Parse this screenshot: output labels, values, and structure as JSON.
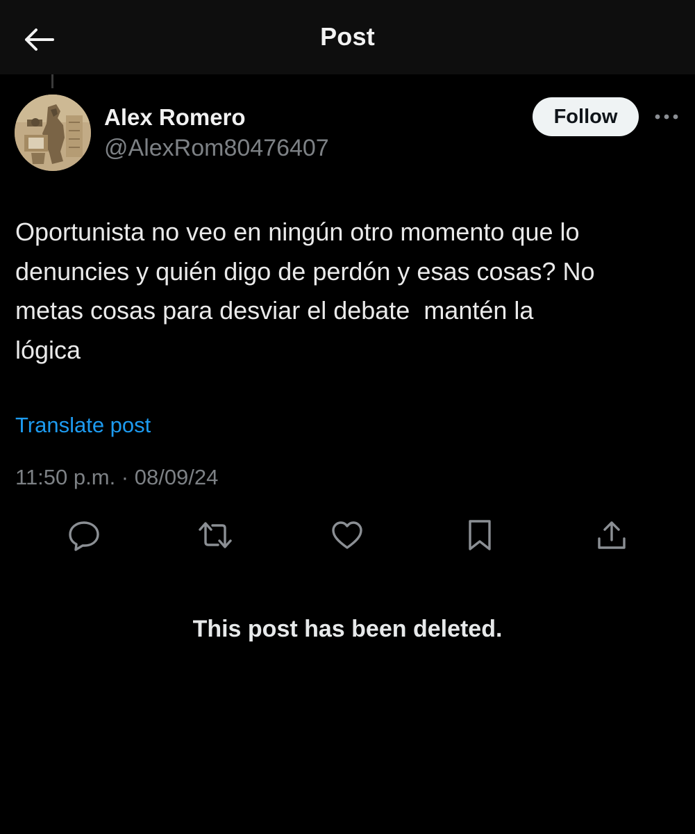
{
  "header": {
    "title": "Post",
    "back_icon": "arrow-left-icon"
  },
  "author": {
    "display_name": "Alex Romero",
    "handle": "@AlexRom80476407",
    "follow_label": "Follow",
    "more_icon": "more-horizontal-icon"
  },
  "post": {
    "text": "Oportunista no veo en ningún otro momento que lo\ndenuncies y quién digo de perdón y esas cosas? No\nmetas cosas para desviar el debate  mantén la\nlógica",
    "translate_label": "Translate post",
    "timestamp": "11:50 p.m. · 08/09/24"
  },
  "actions": [
    {
      "name": "reply",
      "icon": "reply-icon"
    },
    {
      "name": "repost",
      "icon": "repost-icon"
    },
    {
      "name": "like",
      "icon": "heart-icon"
    },
    {
      "name": "bookmark",
      "icon": "bookmark-icon"
    },
    {
      "name": "share",
      "icon": "share-icon"
    }
  ],
  "deleted_notice": "This post has been deleted.",
  "colors": {
    "background": "#000000",
    "header_bg": "#0e0e0e",
    "link": "#1d9bf0",
    "secondary_text": "#7d8185",
    "icon": "#8b8f94"
  }
}
